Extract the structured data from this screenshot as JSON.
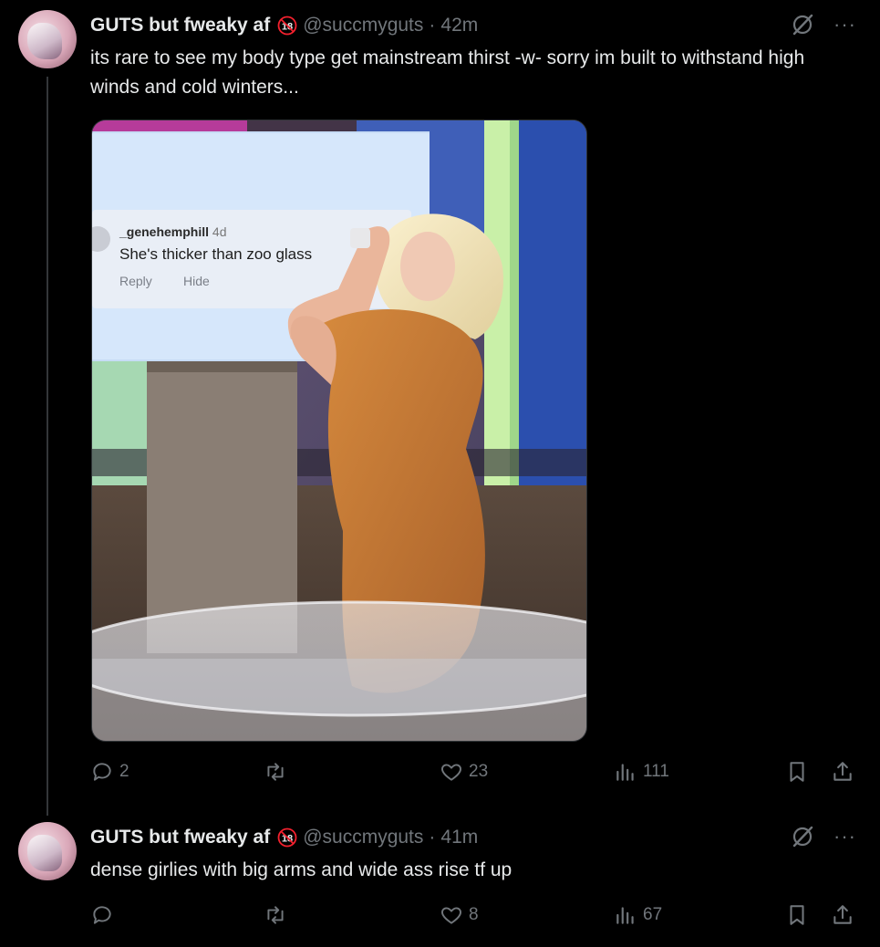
{
  "tweets": [
    {
      "author_name": "GUTS but fweaky af",
      "badge": "18",
      "handle": "@succmyguts",
      "separator": "·",
      "time": "42m",
      "text": "its rare to see my body type get mainstream thirst -w- sorry im built to withstand high winds and cold winters...",
      "media": {
        "comment_user": "_genehemphill",
        "comment_age": "4d",
        "comment_text": "She's thicker than zoo glass",
        "comment_reply": "Reply",
        "comment_hide": "Hide"
      },
      "stats": {
        "replies": "2",
        "reposts": "",
        "likes": "23",
        "views": "111"
      }
    },
    {
      "author_name": "GUTS but fweaky af",
      "badge": "18",
      "handle": "@succmyguts",
      "separator": "·",
      "time": "41m",
      "text": "dense girlies with big arms and wide ass rise tf up",
      "stats": {
        "replies": "",
        "reposts": "",
        "likes": "8",
        "views": "67"
      }
    }
  ],
  "icons": {
    "reply": "reply-icon",
    "repost": "repost-icon",
    "like": "heart-icon",
    "views": "views-icon",
    "bookmark": "bookmark-icon",
    "share": "share-icon",
    "grok": "grok-icon",
    "more": "more-icon"
  },
  "colors": {
    "background": "#000000",
    "text": "#e7e9ea",
    "muted": "#71767b",
    "badge_red": "#f4212e"
  }
}
